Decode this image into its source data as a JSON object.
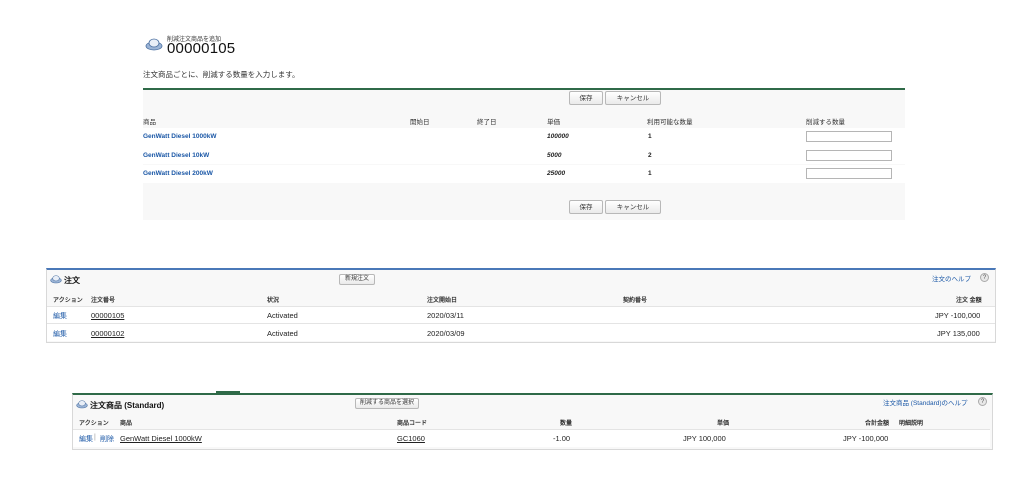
{
  "header": {
    "subtitle": "削減注文商品を追加",
    "title": "00000105",
    "instruction": "注文商品ごとに、削減する数量を入力します。"
  },
  "reduce_form": {
    "save_label": "保存",
    "cancel_label": "キャンセル",
    "columns": {
      "product": "商品",
      "start_date": "開始日",
      "end_date": "終了日",
      "unit_price": "単価",
      "available_qty": "利用可能な数量",
      "reduce_qty": "削減する数量"
    },
    "rows": [
      {
        "product": "GenWatt Diesel 1000kW",
        "unit_price": "100000",
        "available_qty": "1",
        "reduce_qty": ""
      },
      {
        "product": "GenWatt Diesel 10kW",
        "unit_price": "5000",
        "available_qty": "2",
        "reduce_qty": ""
      },
      {
        "product": "GenWatt Diesel 200kW",
        "unit_price": "25000",
        "available_qty": "1",
        "reduce_qty": ""
      }
    ]
  },
  "orders": {
    "title": "注文",
    "new_button": "新規注文",
    "help_link": "注文のヘルプ",
    "help_icon": "?",
    "columns": {
      "action": "アクション",
      "order_number": "注文番号",
      "status": "状況",
      "start_date": "注文開始日",
      "contract_number": "契約番号",
      "amount": "注文 金額"
    },
    "rows": [
      {
        "action": "編集",
        "order_number": "00000105",
        "status": "Activated",
        "start_date": "2020/03/11",
        "contract_number": "",
        "amount": "JPY -100,000"
      },
      {
        "action": "編集",
        "order_number": "00000102",
        "status": "Activated",
        "start_date": "2020/03/09",
        "contract_number": "",
        "amount": "JPY 135,000"
      }
    ]
  },
  "order_products": {
    "title": "注文商品 (Standard)",
    "select_button": "削減する商品を選択",
    "help_link": "注文商品 (Standard)のヘルプ",
    "help_icon": "?",
    "columns": {
      "action": "アクション",
      "product": "商品",
      "product_code": "商品コード",
      "quantity": "数量",
      "unit_price": "単価",
      "total": "合計金額",
      "description": "明細説明"
    },
    "rows": [
      {
        "edit": "編集",
        "separator": "|",
        "delete": "削除",
        "product": "GenWatt Diesel 1000kW",
        "product_code": "GC1060",
        "quantity": "-1.00",
        "unit_price": "JPY 100,000",
        "total": "JPY -100,000",
        "description": ""
      }
    ]
  },
  "icons": {
    "section_icon": "order-disc-icon",
    "help_icon": "help-question-icon"
  },
  "colors": {
    "accent_green": "#2f6a48",
    "accent_blue": "#4a78b8",
    "link": "#1a57a6"
  }
}
